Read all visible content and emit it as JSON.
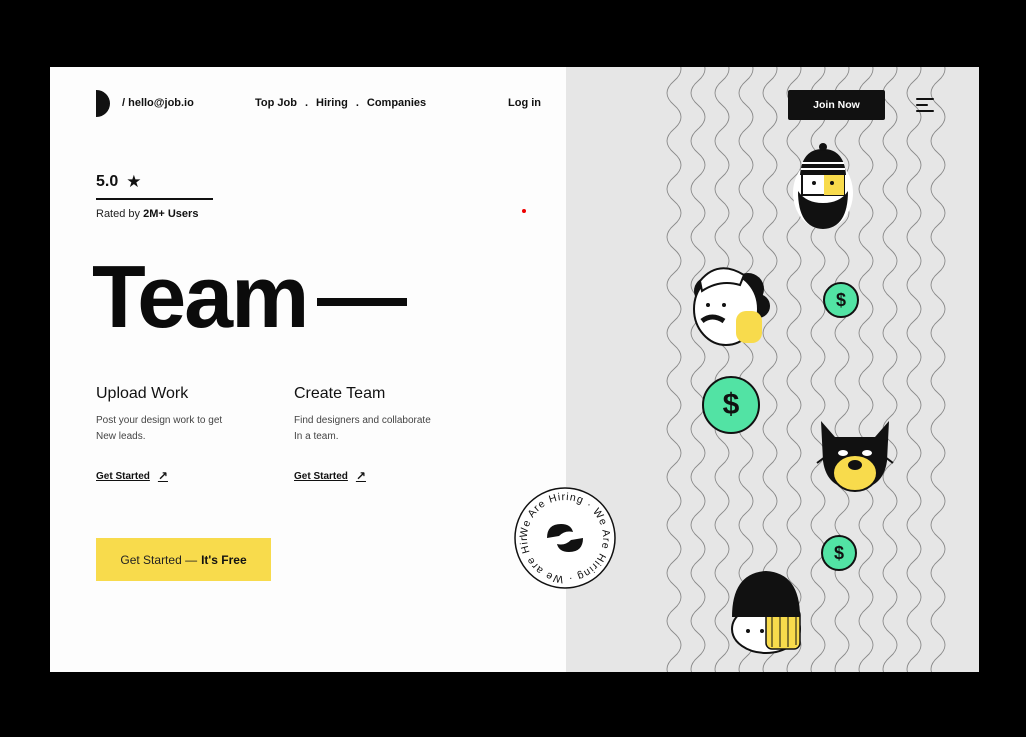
{
  "header": {
    "email": "/ hello@job.io",
    "nav": [
      {
        "label": "Top Job"
      },
      {
        "label": "Hiring"
      },
      {
        "label": "Companies"
      }
    ],
    "nav_separator": ".",
    "login": "Log in",
    "join": "Join Now"
  },
  "rating": {
    "score": "5.0",
    "star": "★",
    "rated_prefix": "Rated by",
    "rated_count": "2M+ Users"
  },
  "hero": {
    "title": "Team"
  },
  "features": [
    {
      "title": "Upload Work",
      "line1": "Post your design work to get",
      "line2": "New leads.",
      "link": "Get Started",
      "arrow": "↗"
    },
    {
      "title": "Create Team",
      "line1": "Find designers and collaborate",
      "line2": "In a team.",
      "link": "Get Started",
      "arrow": "↗"
    }
  ],
  "cta": {
    "prefix": "Get Started —",
    "bold": "It's Free"
  },
  "badge": {
    "text": "We Are Hiring · We Are Hiring · We are Hiring ·"
  },
  "coins": {
    "symbol": "$"
  },
  "colors": {
    "accent_yellow": "#f8db4c",
    "coin_green": "#52e3a4",
    "panel_gray": "#e6e6e6",
    "ink": "#111111"
  },
  "icons": [
    "logo-half-circle-icon",
    "menu-icon",
    "star-icon",
    "arrow-up-right-icon",
    "swirl-logo-icon",
    "dollar-coin-icon"
  ]
}
